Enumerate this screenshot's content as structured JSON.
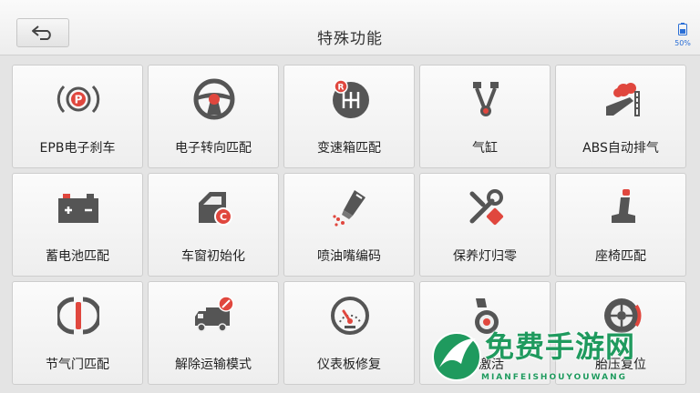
{
  "header": {
    "title": "特殊功能",
    "battery": "50%"
  },
  "functions": [
    {
      "label": "EPB电子刹车",
      "icon": "parking-brake-icon"
    },
    {
      "label": "电子转向匹配",
      "icon": "steering-wheel-icon"
    },
    {
      "label": "变速箱匹配",
      "icon": "gearbox-icon"
    },
    {
      "label": "气缸",
      "icon": "cylinder-icon"
    },
    {
      "label": "ABS自动排气",
      "icon": "abs-bleed-icon"
    },
    {
      "label": "蓄电池匹配",
      "icon": "battery-icon"
    },
    {
      "label": "车窗初始化",
      "icon": "car-window-icon"
    },
    {
      "label": "喷油嘴编码",
      "icon": "injector-icon"
    },
    {
      "label": "保养灯归零",
      "icon": "maintenance-icon"
    },
    {
      "label": "座椅匹配",
      "icon": "seat-icon"
    },
    {
      "label": "节气门匹配",
      "icon": "throttle-icon"
    },
    {
      "label": "解除运输模式",
      "icon": "transport-truck-icon"
    },
    {
      "label": "仪表板修复",
      "icon": "dashboard-gauge-icon"
    },
    {
      "label": "泵激活",
      "icon": "pump-icon"
    },
    {
      "label": "胎压复位",
      "icon": "tire-icon"
    }
  ],
  "watermark": {
    "title": "免费手游网",
    "subtitle": "MIANFEISHOUYOUWANG"
  },
  "colors": {
    "icon_gray": "#5a5a5a",
    "icon_red": "#e0473e",
    "accent_blue": "#2b6fd6",
    "watermark_green": "#1f9a5e"
  }
}
